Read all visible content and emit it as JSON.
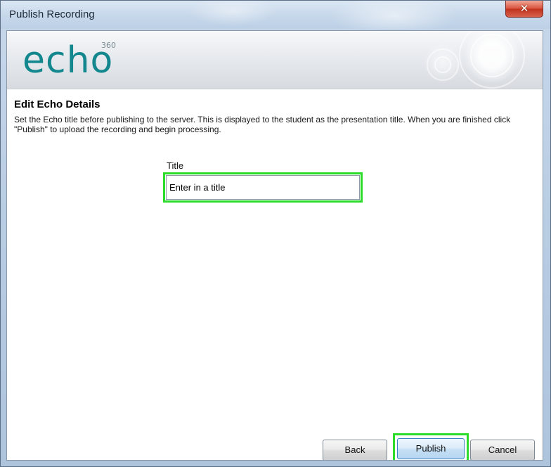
{
  "window": {
    "title": "Publish Recording",
    "close_symbol": "✕"
  },
  "banner": {
    "logo_text": "echo",
    "logo_superscript": "360"
  },
  "content": {
    "heading": "Edit Echo Details",
    "description": "Set the Echo title before publishing to the server. This is displayed to the student as the presentation title. When you are finished click \"Publish\" to upload the recording and begin processing."
  },
  "form": {
    "title_label": "Title",
    "title_value": "Enter in a title"
  },
  "buttons": {
    "back": "Back",
    "publish": "Publish",
    "cancel": "Cancel"
  },
  "colors": {
    "logo": "#12878d",
    "highlight": "#2bdc2b"
  }
}
